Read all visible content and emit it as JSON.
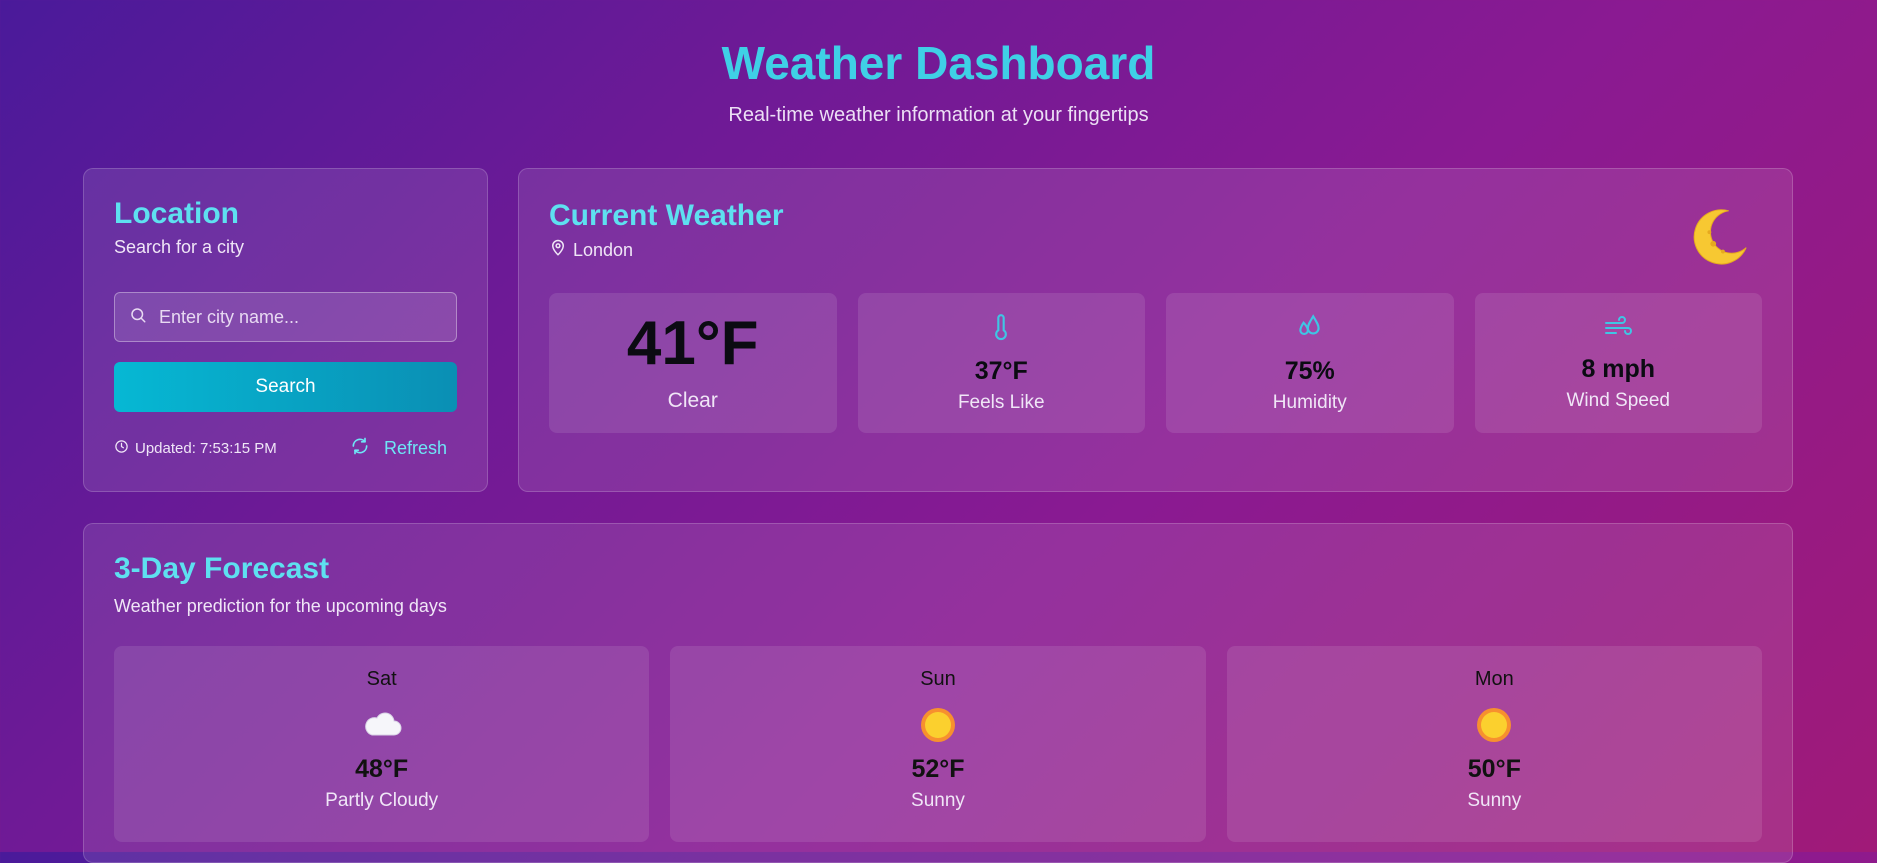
{
  "header": {
    "title": "Weather Dashboard",
    "subtitle": "Real-time weather information at your fingertips"
  },
  "location": {
    "title": "Location",
    "subtitle": "Search for a city",
    "search_placeholder": "Enter city name...",
    "search_value": "",
    "search_button": "Search",
    "updated": "Updated: 7:53:15 PM",
    "refresh": "Refresh"
  },
  "current": {
    "title": "Current Weather",
    "city": "London",
    "icon": "crescent-moon-icon",
    "temperature": "41°F",
    "condition": "Clear",
    "stats": [
      {
        "icon": "thermometer-icon",
        "value": "37°F",
        "label": "Feels Like"
      },
      {
        "icon": "droplets-icon",
        "value": "75%",
        "label": "Humidity"
      },
      {
        "icon": "wind-icon",
        "value": "8 mph",
        "label": "Wind Speed"
      }
    ]
  },
  "forecast": {
    "title": "3-Day Forecast",
    "subtitle": "Weather prediction for the upcoming days",
    "days": [
      {
        "day": "Sat",
        "icon": "cloud-icon",
        "temp": "48°F",
        "condition": "Partly Cloudy"
      },
      {
        "day": "Sun",
        "icon": "sun-icon",
        "temp": "52°F",
        "condition": "Sunny"
      },
      {
        "day": "Mon",
        "icon": "sun-icon",
        "temp": "50°F",
        "condition": "Sunny"
      }
    ]
  },
  "colors": {
    "accent": "#3fd0e6",
    "button": "#06b8d4",
    "refresh": "#6ee6f6"
  }
}
